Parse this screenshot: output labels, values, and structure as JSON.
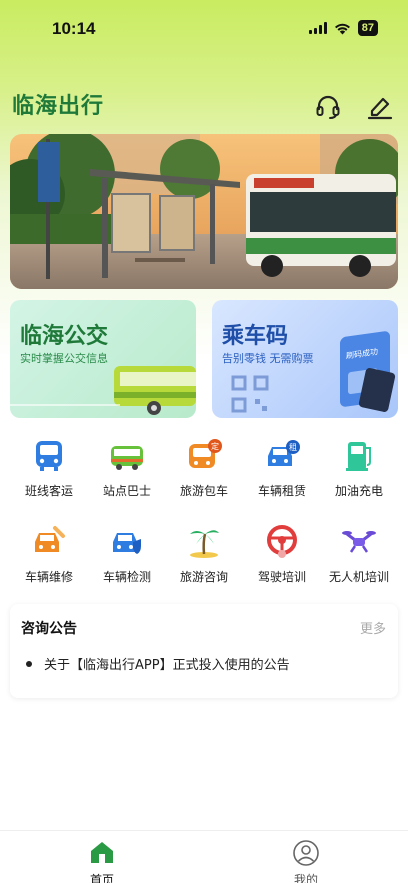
{
  "status_bar": {
    "time": "10:14",
    "battery": "87"
  },
  "header": {
    "brand": "临海出行",
    "icons": [
      "headset-icon",
      "edit-icon"
    ]
  },
  "banner": {
    "image": "bus-stop-photo"
  },
  "cards": [
    {
      "title": "临海公交",
      "subtitle": "实时掌握公交信息",
      "color": "#1f7a3a"
    },
    {
      "title": "乘车码",
      "subtitle": "告别零钱 无需购票",
      "color": "#1f4fa8",
      "badge": "刷码成功"
    }
  ],
  "services": [
    {
      "label": "班线客运",
      "icon": "bus-icon"
    },
    {
      "label": "站点巴士",
      "icon": "minibus-icon"
    },
    {
      "label": "旅游包车",
      "icon": "charter-bus-icon",
      "badge": "定"
    },
    {
      "label": "车辆租赁",
      "icon": "car-rental-icon",
      "badge": "租"
    },
    {
      "label": "加油充电",
      "icon": "charging-station-icon"
    },
    {
      "label": "车辆维修",
      "icon": "car-repair-icon"
    },
    {
      "label": "车辆检测",
      "icon": "car-inspection-icon"
    },
    {
      "label": "旅游咨询",
      "icon": "palm-tree-icon"
    },
    {
      "label": "驾驶培训",
      "icon": "steering-wheel-icon"
    },
    {
      "label": "无人机培训",
      "icon": "drone-icon"
    }
  ],
  "notice": {
    "title": "咨询公告",
    "more": "更多",
    "items": [
      "关于【临海出行APP】正式投入使用的公告"
    ]
  },
  "tabbar": {
    "tabs": [
      {
        "label": "首页",
        "icon": "home-icon",
        "active": true
      },
      {
        "label": "我的",
        "icon": "profile-icon",
        "active": false
      }
    ],
    "active_color": "#1f7a3a"
  }
}
